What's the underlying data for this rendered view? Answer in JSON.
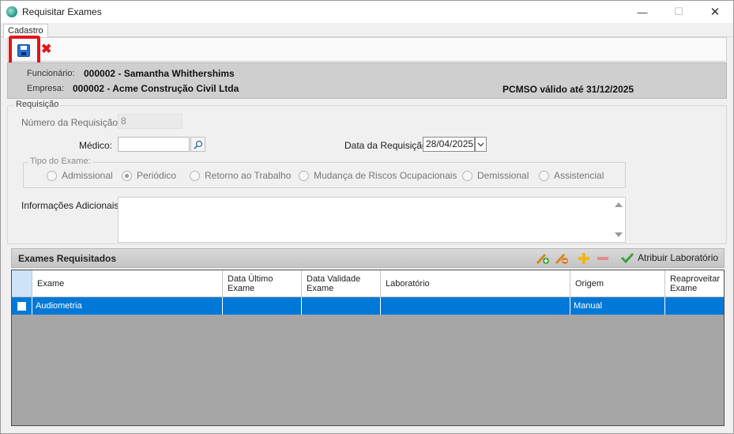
{
  "window": {
    "title": "Requisitar Exames",
    "minimize_glyph": "—",
    "maximize_glyph": "☐",
    "close_glyph": "✕"
  },
  "tabs": [
    {
      "label": "Cadastro"
    }
  ],
  "toolbar": {
    "save_icon": "floppy-disk-icon",
    "cancel_glyph": "✖"
  },
  "info": {
    "funcionario_label": "Funcionário:",
    "funcionario_value": "000002 - Samantha Whithershims",
    "empresa_label": "Empresa:",
    "empresa_value": "000002 - Acme Construção Civil Ltda",
    "pcmso": "PCMSO válido até 31/12/2025"
  },
  "requisicao": {
    "group_title": "Requisição",
    "numero_label": "Número da Requisição:",
    "numero_value": "8",
    "medico_label": "Médico:",
    "medico_value": "",
    "data_label": "Data da Requisição:",
    "data_value": "28/04/2025",
    "tipo_title": "Tipo do Exame:",
    "tipo_options": [
      {
        "label": "Admissional",
        "checked": false
      },
      {
        "label": "Periódico",
        "checked": true
      },
      {
        "label": "Retorno ao Trabalho",
        "checked": false
      },
      {
        "label": "Mudança de Riscos Ocupacionais",
        "checked": false
      },
      {
        "label": "Demissional",
        "checked": false
      },
      {
        "label": "Assistencial",
        "checked": false
      }
    ],
    "info_label": "Informações Adicionais:",
    "info_value": ""
  },
  "exames": {
    "title": "Exames Requisitados",
    "attribute_label": "Atribuir Laboratório",
    "columns": [
      "Exame",
      "Data Último Exame",
      "Data Validade Exame",
      "Laboratório",
      "Origem",
      "Reaproveitar Exame"
    ],
    "rows": [
      {
        "exame": "Audiometria",
        "data_ultimo": "",
        "data_validade": "",
        "laboratorio": "",
        "origem": "Manual",
        "reaproveitar": ""
      }
    ]
  },
  "colors": {
    "highlight_red": "#e3141c",
    "selection_blue": "#0078d7",
    "panel_gray": "#cfcfcf"
  }
}
